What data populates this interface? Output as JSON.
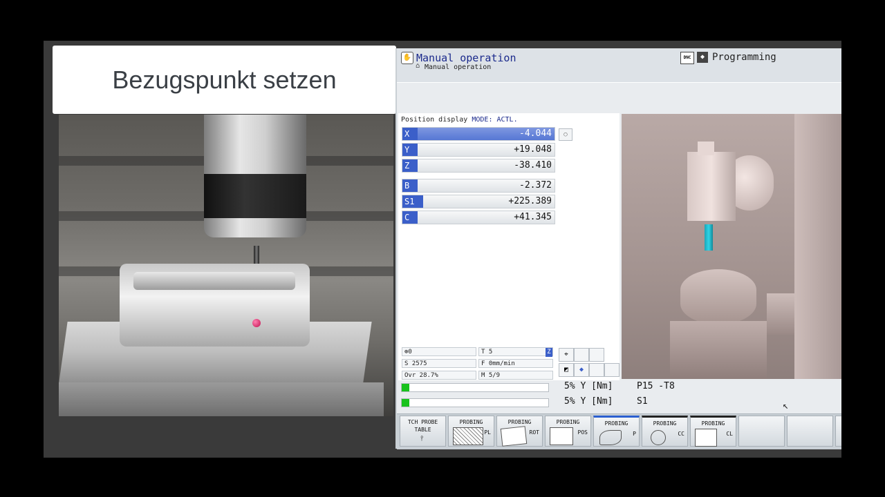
{
  "title_card": {
    "text": "Bezugspunkt setzen"
  },
  "header": {
    "mode_icon": "hand-icon",
    "mode_title": "Manual operation",
    "mode_subtitle": "Manual operation",
    "dnc_badge": "DNC",
    "programming_label": "Programming"
  },
  "position_display": {
    "label": "Position display",
    "mode": "MODE: ACTL.",
    "axes": [
      {
        "name": "X",
        "value": "-4.044",
        "active": true
      },
      {
        "name": "Y",
        "value": "+19.048"
      },
      {
        "name": "Z",
        "value": "-38.410"
      },
      {
        "name": "B",
        "value": "-2.372"
      },
      {
        "name": "S1",
        "value": "+225.389"
      },
      {
        "name": "C",
        "value": "+41.345"
      }
    ]
  },
  "status": {
    "probe": "0",
    "tool": "T 5",
    "tool_axis": "Z",
    "spindle": "S 2575",
    "feed": "F 0mm/min",
    "override": "Ovr 28.7%",
    "m_code": "M 5/9"
  },
  "load_bars": [
    {
      "percent": 5,
      "text": "5% Y [Nm]",
      "extra": "P15 -T8"
    },
    {
      "percent": 5,
      "text": "5% Y [Nm]",
      "extra": "S1"
    }
  ],
  "softkeys": [
    {
      "line1": "TCH PROBE",
      "line2": "TABLE"
    },
    {
      "line1": "PROBING",
      "line2": "PL"
    },
    {
      "line1": "PROBING",
      "line2": "ROT"
    },
    {
      "line1": "PROBING",
      "line2": "POS"
    },
    {
      "line1": "PROBING",
      "line2": "P"
    },
    {
      "line1": "PROBING",
      "line2": "CC"
    },
    {
      "line1": "PROBING",
      "line2": "CL"
    }
  ],
  "colors": {
    "axis_label_blue": "#3b5fc9",
    "load_green": "#18c21c",
    "tool_cyan": "#2fd4e6"
  }
}
